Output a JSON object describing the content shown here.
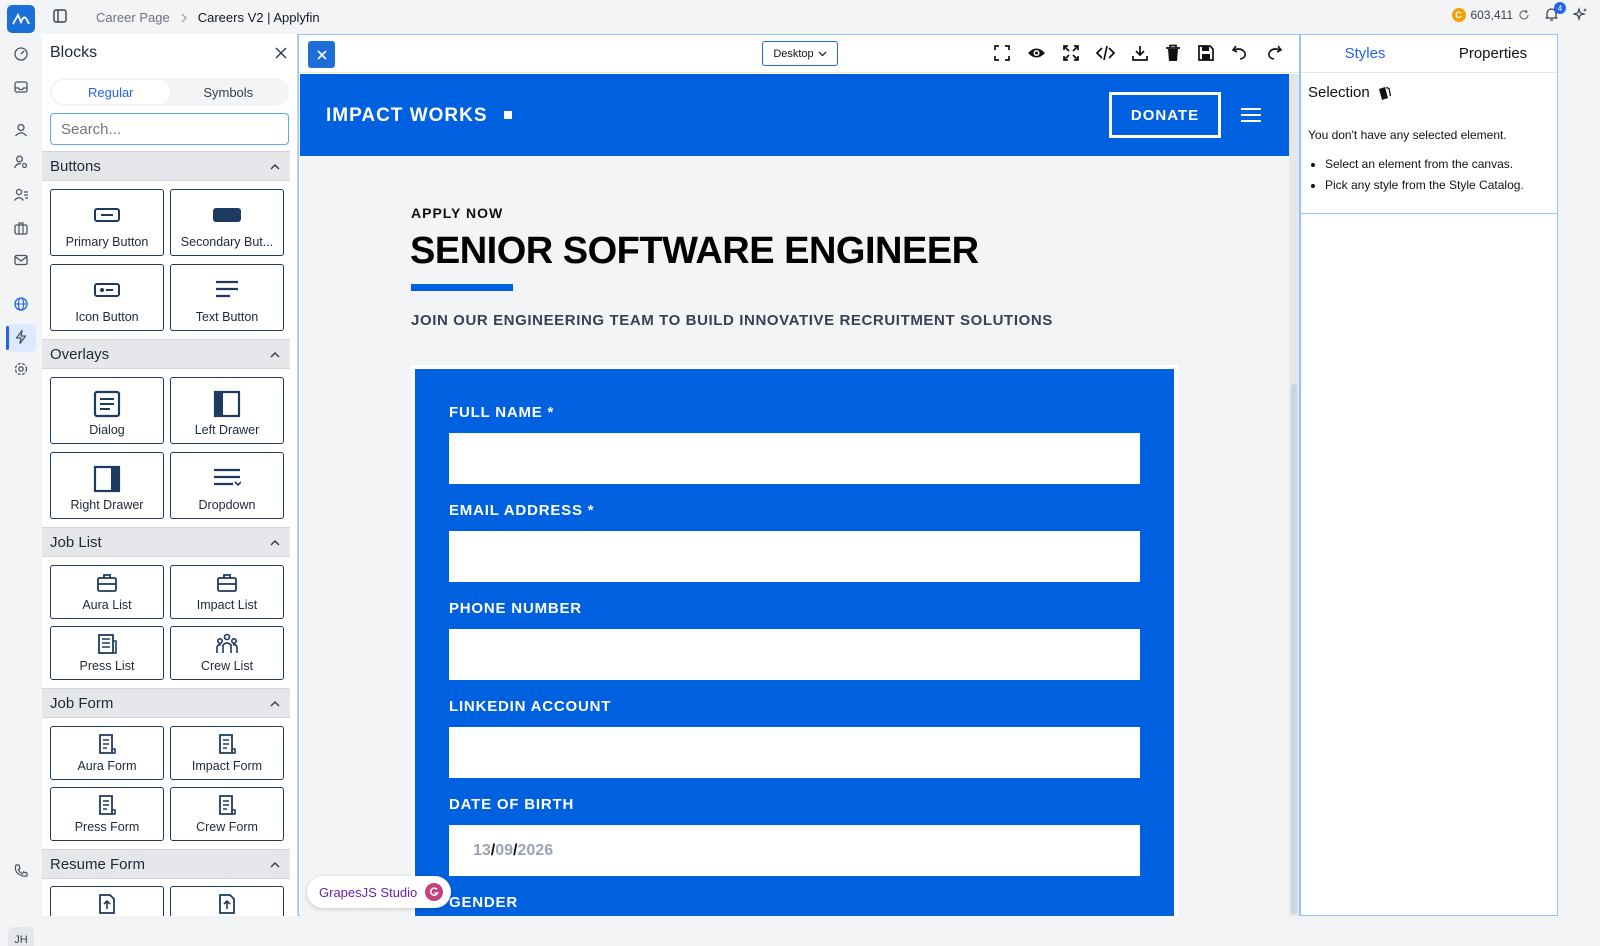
{
  "topbar": {
    "breadcrumb_parent": "Career Page",
    "breadcrumb_current": "Careers V2 | Applyfin",
    "credits": "603,411",
    "notifications_count": "4",
    "coin_symbol": "C"
  },
  "rail": {
    "avatar_initials": "JH",
    "icons": [
      "dashboard-icon",
      "inbox-icon",
      "candidate-icon",
      "user-search-icon",
      "users-icon",
      "briefcase-icon",
      "mail-icon",
      "globe-icon",
      "lightning-icon",
      "settings-icon",
      "phone-icon"
    ],
    "active_item": "globe-icon"
  },
  "blocks_panel": {
    "title": "Blocks",
    "tabs": [
      {
        "label": "Regular",
        "active": true
      },
      {
        "label": "Symbols",
        "active": false
      }
    ],
    "search_placeholder": "Search...",
    "categories": [
      {
        "label": "Buttons",
        "items": [
          {
            "label": "Primary Button",
            "icon": "button-icon"
          },
          {
            "label": "Secondary But...",
            "icon": "filled-button-icon"
          },
          {
            "label": "Icon Button",
            "icon": "icon-button-icon"
          },
          {
            "label": "Text Button",
            "icon": "text-lines-icon"
          }
        ]
      },
      {
        "label": "Overlays",
        "items": [
          {
            "label": "Dialog",
            "icon": "dialog-icon"
          },
          {
            "label": "Left Drawer",
            "icon": "left-drawer-icon"
          },
          {
            "label": "Right Drawer",
            "icon": "right-drawer-icon"
          },
          {
            "label": "Dropdown",
            "icon": "dropdown-icon"
          }
        ]
      },
      {
        "label": "Job List",
        "items": [
          {
            "label": "Aura List",
            "icon": "briefcase-icon"
          },
          {
            "label": "Impact List",
            "icon": "briefcase-icon"
          },
          {
            "label": "Press List",
            "icon": "newspaper-icon"
          },
          {
            "label": "Crew List",
            "icon": "crew-icon"
          }
        ]
      },
      {
        "label": "Job Form",
        "items": [
          {
            "label": "Aura Form",
            "icon": "form-icon"
          },
          {
            "label": "Impact Form",
            "icon": "form-icon"
          },
          {
            "label": "Press Form",
            "icon": "form-icon"
          },
          {
            "label": "Crew Form",
            "icon": "form-icon"
          }
        ]
      },
      {
        "label": "Resume Form",
        "items": [
          {
            "label": "",
            "icon": "upload-file-icon"
          },
          {
            "label": "",
            "icon": "upload-file-icon"
          }
        ]
      }
    ]
  },
  "canvas": {
    "device": "Desktop",
    "toolbar_icons": [
      "outline-icon",
      "preview-icon",
      "fullscreen-icon",
      "code-icon",
      "download-icon",
      "trash-icon",
      "save-icon",
      "undo-icon",
      "redo-icon"
    ],
    "site": {
      "brand": "IMPACT WORKS",
      "donate": "DONATE",
      "eyebrow": "APPLY NOW",
      "job_title": "SENIOR SOFTWARE ENGINEER",
      "subtitle": "JOIN OUR ENGINEERING TEAM TO BUILD INNOVATIVE RECRUITMENT SOLUTIONS",
      "fields": [
        {
          "label": "FULL NAME *",
          "value": ""
        },
        {
          "label": "EMAIL ADDRESS *",
          "value": ""
        },
        {
          "label": "PHONE NUMBER",
          "value": ""
        },
        {
          "label": "LINKEDIN ACCOUNT",
          "value": ""
        },
        {
          "label": "DATE OF BIRTH",
          "value": ""
        },
        {
          "label": "GENDER",
          "value": ""
        }
      ],
      "date_placeholder": {
        "dd": "13",
        "mm": "09",
        "yyyy": "2026",
        "sep": "/"
      }
    },
    "badge": "GrapesJS Studio"
  },
  "right_panel": {
    "tabs": [
      {
        "label": "Styles",
        "active": true
      },
      {
        "label": "Properties",
        "active": false
      }
    ],
    "selection_title": "Selection",
    "empty_message": "You don't have any selected element.",
    "tips": [
      "Select an element from the canvas.",
      "Pick any style from the Style Catalog."
    ]
  },
  "colors": {
    "brand_blue": "#0061e0",
    "accent": "#2563eb",
    "navy": "#1e3a5f"
  }
}
